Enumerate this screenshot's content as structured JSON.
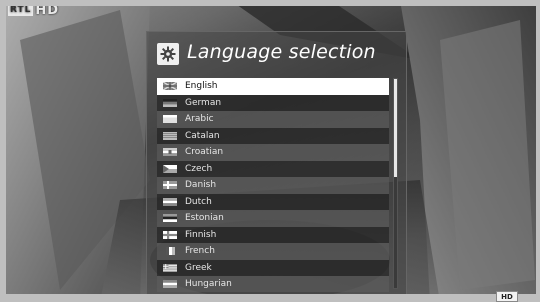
{
  "channel": {
    "logo_letters": "RTL",
    "logo_suffix": "HD"
  },
  "dialog": {
    "title": "Language selection",
    "icon": "gear-icon"
  },
  "languages": [
    {
      "label": "English",
      "flag": "english-flag-icon",
      "selected": true
    },
    {
      "label": "German",
      "flag": "german-flag-icon",
      "selected": false
    },
    {
      "label": "Arabic",
      "flag": "arabic-flag-icon",
      "selected": false
    },
    {
      "label": "Catalan",
      "flag": "catalan-flag-icon",
      "selected": false
    },
    {
      "label": "Croatian",
      "flag": "croatian-flag-icon",
      "selected": false
    },
    {
      "label": "Czech",
      "flag": "czech-flag-icon",
      "selected": false
    },
    {
      "label": "Danish",
      "flag": "danish-flag-icon",
      "selected": false
    },
    {
      "label": "Dutch",
      "flag": "dutch-flag-icon",
      "selected": false
    },
    {
      "label": "Estonian",
      "flag": "estonian-flag-icon",
      "selected": false
    },
    {
      "label": "Finnish",
      "flag": "finnish-flag-icon",
      "selected": false
    },
    {
      "label": "French",
      "flag": "french-flag-icon",
      "selected": false
    },
    {
      "label": "Greek",
      "flag": "greek-flag-icon",
      "selected": false
    },
    {
      "label": "Hungarian",
      "flag": "hungarian-flag-icon",
      "selected": false
    }
  ],
  "scroll": {
    "visible_fraction": 0.47
  },
  "badge": {
    "label": "HD"
  }
}
